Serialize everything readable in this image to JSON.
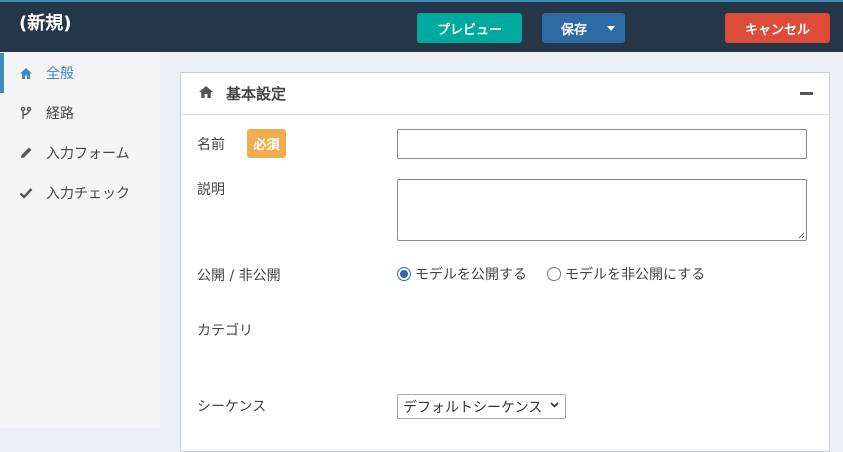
{
  "header": {
    "title": "(新規)",
    "preview_label": "プレビュー",
    "save_label": "保存",
    "cancel_label": "キャンセル"
  },
  "sidebar": {
    "items": [
      {
        "label": "全般",
        "icon": "home-icon",
        "active": true
      },
      {
        "label": "経路",
        "icon": "fork-icon",
        "active": false
      },
      {
        "label": "入力フォーム",
        "icon": "pencil-icon",
        "active": false
      },
      {
        "label": "入力チェック",
        "icon": "check-icon",
        "active": false
      }
    ]
  },
  "panel": {
    "title": "基本設定",
    "fields": {
      "name": {
        "label": "名前",
        "required_badge": "必須",
        "value": ""
      },
      "description": {
        "label": "説明",
        "value": ""
      },
      "visibility": {
        "label": "公開 / 非公開",
        "options": [
          "モデルを公開する",
          "モデルを非公開にする"
        ],
        "selected": "モデルを公開する"
      },
      "category": {
        "label": "カテゴリ"
      },
      "sequence": {
        "label": "シーケンス",
        "selected": "デフォルトシーケンス"
      }
    }
  },
  "colors": {
    "header_bg": "#253648",
    "preview": "#00a99d",
    "save": "#2e6aa4",
    "cancel": "#dd4b39",
    "required": "#f0ad4e",
    "active": "#3c8dbc"
  }
}
